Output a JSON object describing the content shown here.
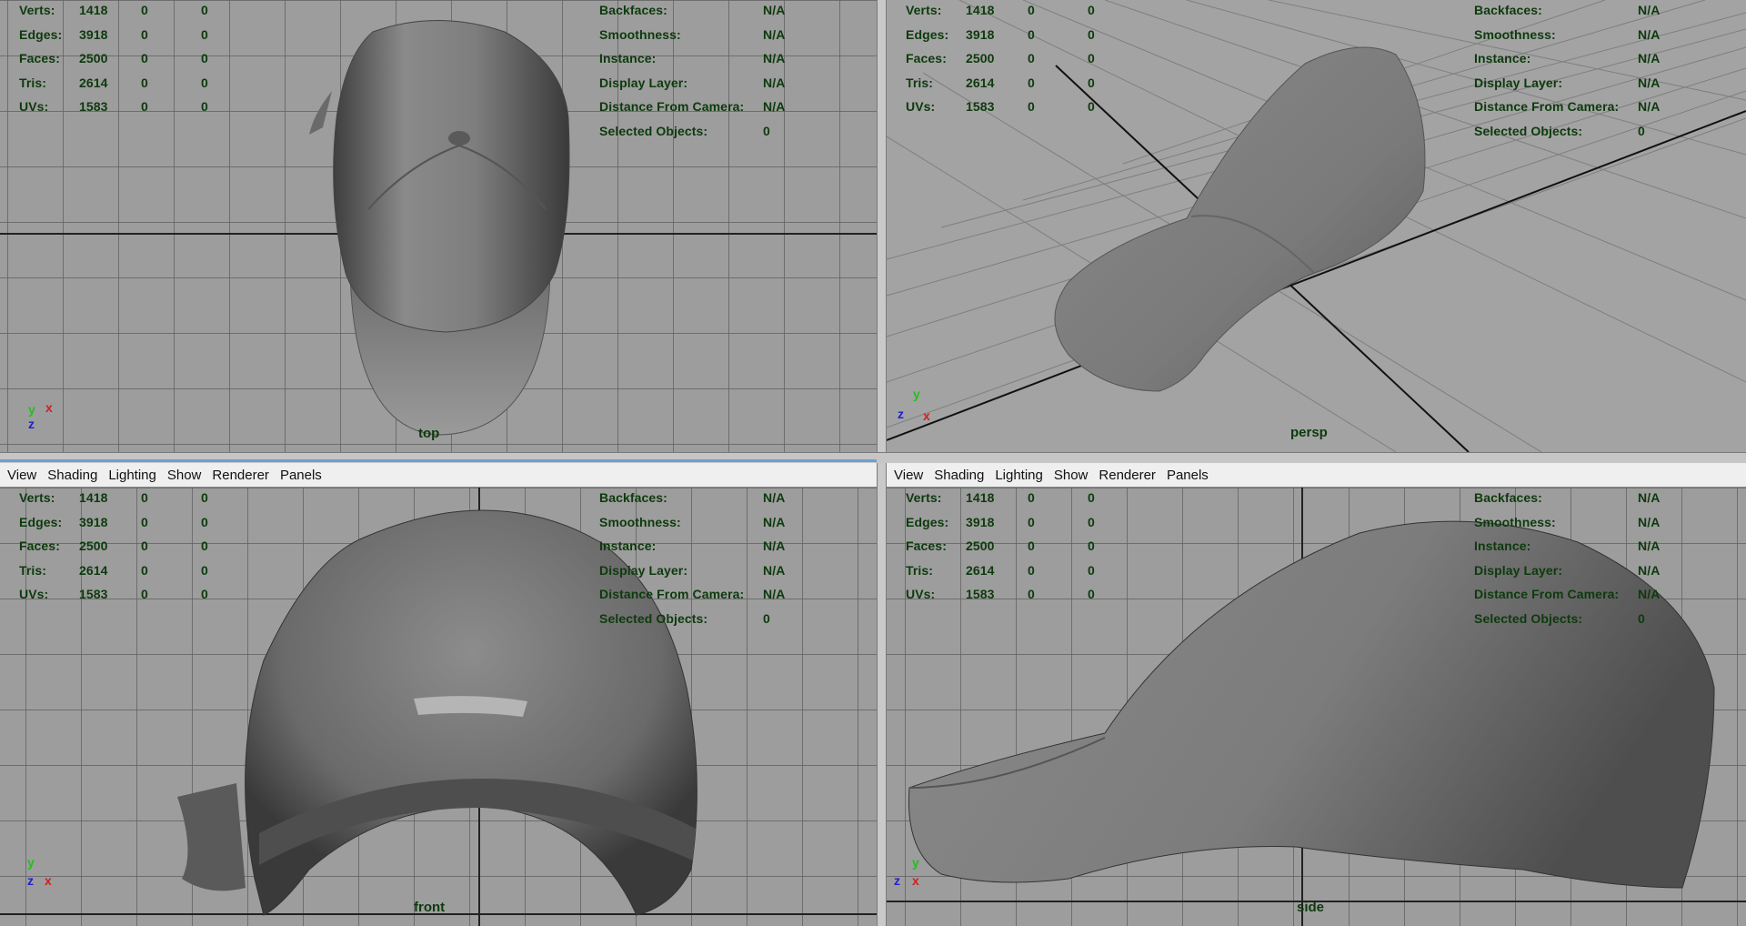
{
  "stats": {
    "left": [
      {
        "label": "Verts:",
        "v1": "1418",
        "v2": "0",
        "v3": "0"
      },
      {
        "label": "Edges:",
        "v1": "3918",
        "v2": "0",
        "v3": "0"
      },
      {
        "label": "Faces:",
        "v1": "2500",
        "v2": "0",
        "v3": "0"
      },
      {
        "label": "Tris:",
        "v1": "2614",
        "v2": "0",
        "v3": "0"
      },
      {
        "label": "UVs:",
        "v1": "1583",
        "v2": "0",
        "v3": "0"
      }
    ],
    "right": [
      {
        "label": "Backfaces:",
        "value": "N/A"
      },
      {
        "label": "Smoothness:",
        "value": "N/A"
      },
      {
        "label": "Instance:",
        "value": "N/A"
      },
      {
        "label": "Display Layer:",
        "value": "N/A"
      },
      {
        "label": "Distance From Camera:",
        "value": "N/A"
      },
      {
        "label": "Selected Objects:",
        "value": "0"
      }
    ]
  },
  "menu": [
    "View",
    "Shading",
    "Lighting",
    "Show",
    "Renderer",
    "Panels"
  ],
  "viewports": {
    "top": {
      "camera": "top"
    },
    "persp": {
      "camera": "persp"
    },
    "front": {
      "camera": "front"
    },
    "side": {
      "camera": "side"
    }
  },
  "axes": {
    "x": "x",
    "y": "y",
    "z": "z"
  },
  "colors": {
    "hud_text": "#0d3a0d",
    "axis_x": "#d02020",
    "axis_y": "#20c020",
    "axis_z": "#2020d0",
    "menubar_bg": "#efefef"
  }
}
